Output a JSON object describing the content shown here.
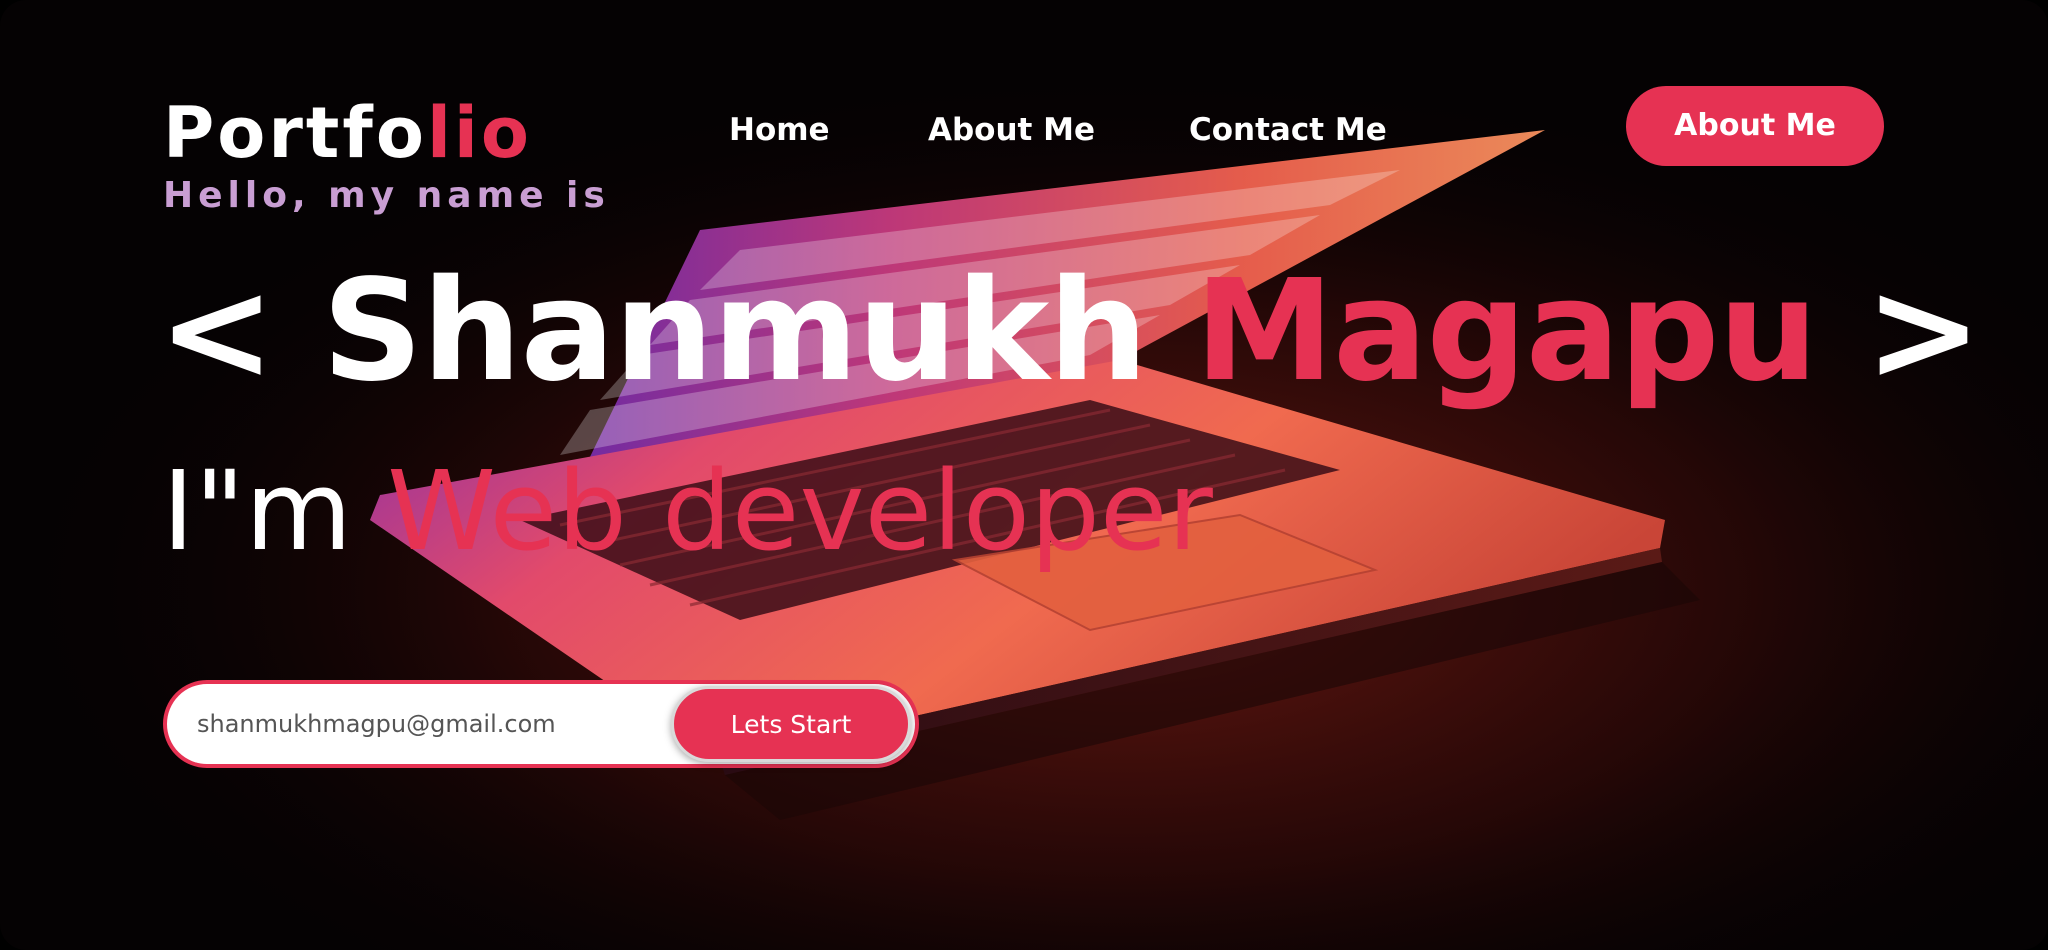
{
  "header": {
    "logo_main": "Portfo",
    "logo_accent": "lio",
    "nav": [
      {
        "label": "Home"
      },
      {
        "label": "About Me"
      },
      {
        "label": "Contact Me"
      }
    ],
    "cta_label": "About Me"
  },
  "hero": {
    "greeting": "Hello, my name is",
    "name_open": "< ",
    "first_name": "Shanmukh ",
    "last_name": "Magapu",
    "name_close": " >",
    "role_prefix": "I\"m ",
    "role": "Web developer"
  },
  "signup": {
    "email_value": "shanmukhmagpu@gmail.com",
    "button_label": "Lets Start"
  },
  "colors": {
    "accent": "#e63253",
    "greeting": "#c99ed3",
    "background": "#050203"
  },
  "icons": {
    "background_image": "laptop-illustration"
  }
}
